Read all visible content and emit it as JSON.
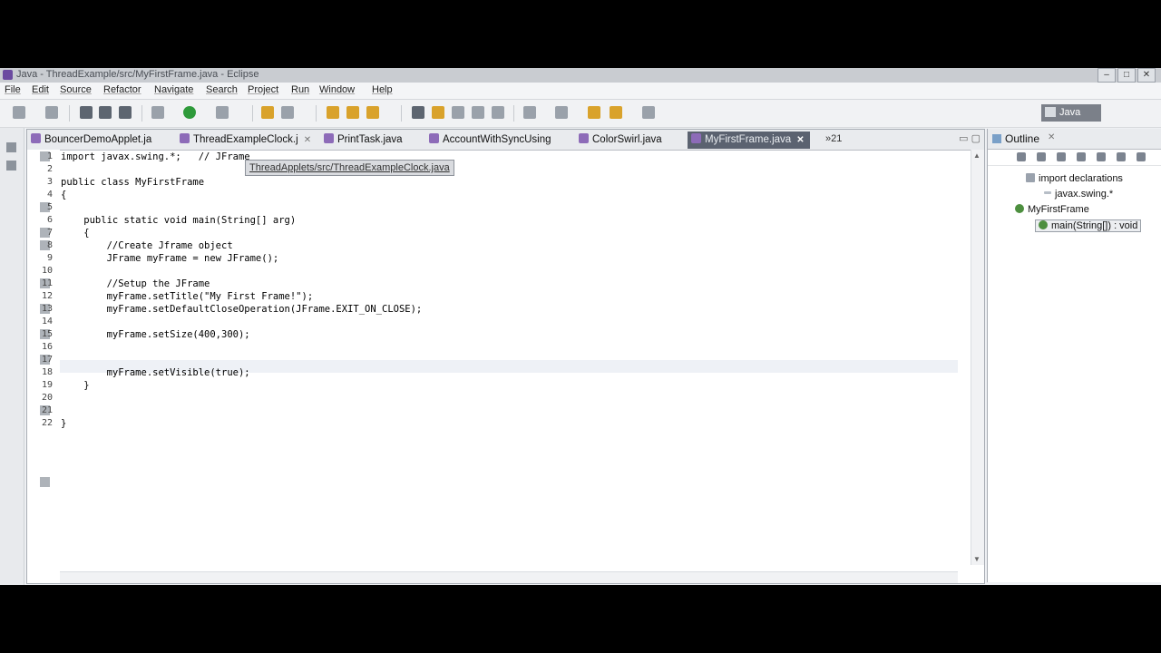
{
  "window": {
    "title": "Java - ThreadExample/src/MyFirstFrame.java - Eclipse",
    "controls": {
      "minimize": "–",
      "maximize": "□",
      "close": "✕"
    }
  },
  "menu": [
    "File",
    "Edit",
    "Source",
    "Refactor",
    "Navigate",
    "Search",
    "Project",
    "Run",
    "Window",
    "Help"
  ],
  "perspective": {
    "label": "Java"
  },
  "editor": {
    "tabs": [
      {
        "label": "BouncerDemoApplet.ja",
        "active": false,
        "close": ""
      },
      {
        "label": "ThreadExampleClock.j",
        "active": false,
        "close": "✕"
      },
      {
        "label": "PrintTask.java",
        "active": false,
        "close": ""
      },
      {
        "label": "AccountWithSyncUsing",
        "active": false,
        "close": ""
      },
      {
        "label": "ColorSwirl.java",
        "active": false,
        "close": ""
      },
      {
        "label": "MyFirstFrame.java",
        "active": true,
        "close": "✕"
      }
    ],
    "overflow": "»21",
    "tooltip": "ThreadApplets/src/ThreadExampleClock.java",
    "lines": [
      {
        "n": "1",
        "text": "import javax.swing.*;   // JFrame"
      },
      {
        "n": "2",
        "text": ""
      },
      {
        "n": "3",
        "text": "public class MyFirstFrame"
      },
      {
        "n": "4",
        "text": "{"
      },
      {
        "n": "5",
        "text": ""
      },
      {
        "n": "6",
        "text": "    public static void main(String[] arg)"
      },
      {
        "n": "7",
        "text": "    {"
      },
      {
        "n": "8",
        "text": "        //Create Jframe object"
      },
      {
        "n": "9",
        "text": "        JFrame myFrame = new JFrame();"
      },
      {
        "n": "10",
        "text": ""
      },
      {
        "n": "11",
        "text": "        //Setup the JFrame"
      },
      {
        "n": "12",
        "text": "        myFrame.setTitle(\"My First Frame!\");"
      },
      {
        "n": "13",
        "text": "        myFrame.setDefaultCloseOperation(JFrame.EXIT_ON_CLOSE);"
      },
      {
        "n": "14",
        "text": ""
      },
      {
        "n": "15",
        "text": "        myFrame.setSize(400,300);"
      },
      {
        "n": "16",
        "text": ""
      },
      {
        "n": "17",
        "text": ""
      },
      {
        "n": "18",
        "text": "        myFrame.setVisible(true);"
      },
      {
        "n": "19",
        "text": "    }"
      },
      {
        "n": "20",
        "text": ""
      },
      {
        "n": "21",
        "text": ""
      },
      {
        "n": "22",
        "text": "}"
      }
    ]
  },
  "outline": {
    "title": "Outline",
    "close": "✕",
    "nodes": [
      {
        "label": "import declarations"
      },
      {
        "label": "javax.swing.*"
      },
      {
        "label": "MyFirstFrame"
      },
      {
        "label": "main(String[]) : void"
      }
    ]
  }
}
